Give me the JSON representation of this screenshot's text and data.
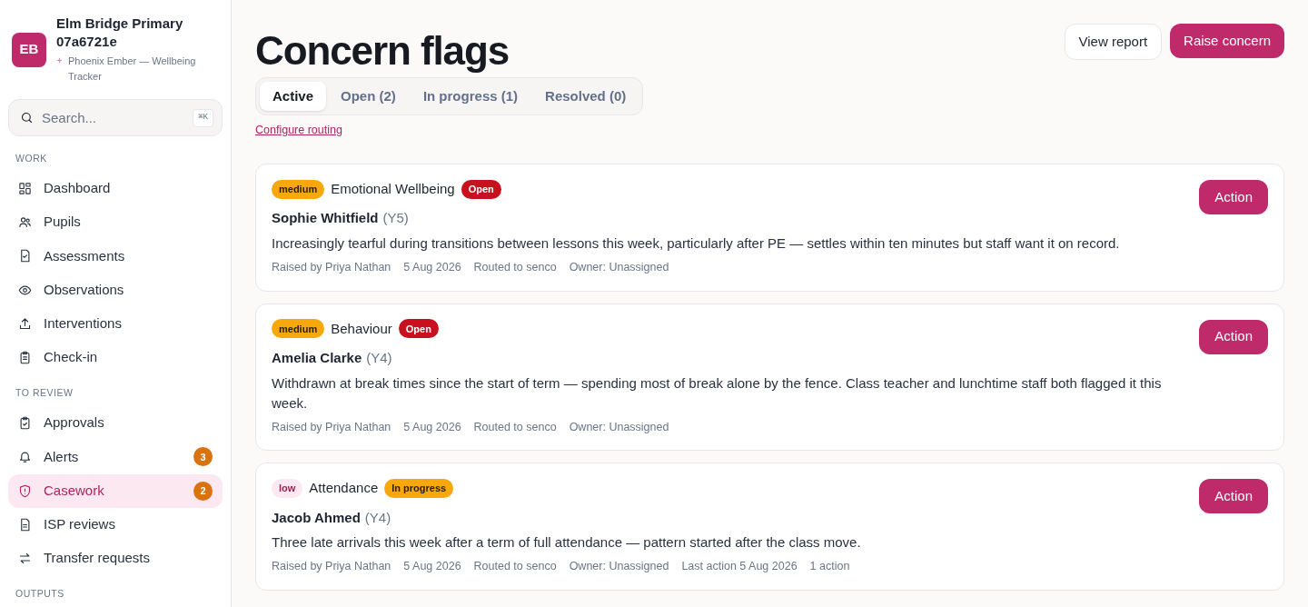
{
  "org": {
    "initials": "EB",
    "name": "Elm Bridge Primary 07a6721e",
    "product": "Phoenix Ember — Wellbeing Tracker"
  },
  "search": {
    "placeholder": "Search...",
    "shortcut": "⌘K"
  },
  "nav_sections": [
    {
      "label": "WORK",
      "items": [
        {
          "label": "Dashboard",
          "selected": false
        },
        {
          "label": "Pupils",
          "selected": false
        },
        {
          "label": "Assessments",
          "selected": false
        },
        {
          "label": "Observations",
          "selected": false
        },
        {
          "label": "Interventions",
          "selected": false
        },
        {
          "label": "Check-in",
          "selected": false
        }
      ]
    },
    {
      "label": "TO REVIEW",
      "items": [
        {
          "label": "Approvals",
          "selected": false
        },
        {
          "label": "Alerts",
          "selected": false,
          "count": "3"
        },
        {
          "label": "Casework",
          "selected": true,
          "count": "2"
        },
        {
          "label": "ISP reviews",
          "selected": false
        },
        {
          "label": "Transfer requests",
          "selected": false
        }
      ]
    },
    {
      "label": "OUTPUTS"
    }
  ],
  "page": {
    "title": "Concern flags",
    "buttons": [
      "View report",
      "Raise concern"
    ],
    "tabs": [
      {
        "label": "Active",
        "selected": true
      },
      {
        "label": "Open (2)",
        "selected": false
      },
      {
        "label": "In progress (1)",
        "selected": false
      },
      {
        "label": "Resolved (0)",
        "selected": false
      }
    ],
    "link": "Configure routing"
  },
  "flags": [
    {
      "severity": {
        "label": "medium",
        "kind": "medium"
      },
      "category": "Emotional Wellbeing",
      "status": {
        "label": "Open",
        "kind": "open"
      },
      "pupil": "Sophie Whitfield",
      "year": "(Y5)",
      "note": "Increasingly tearful during transitions between lessons this week, particularly after PE — settles within ten minutes but staff want it on record.",
      "meta": [
        "Raised by Priya Nathan",
        "5 Aug 2026",
        "Routed to senco",
        "Owner: Unassigned"
      ],
      "action": "Action"
    },
    {
      "severity": {
        "label": "medium",
        "kind": "medium"
      },
      "category": "Behaviour",
      "status": {
        "label": "Open",
        "kind": "open"
      },
      "pupil": "Amelia Clarke",
      "year": "(Y4)",
      "note": "Withdrawn at break times since the start of term — spending most of break alone by the fence. Class teacher and lunchtime staff both flagged it this week.",
      "meta": [
        "Raised by Priya Nathan",
        "5 Aug 2026",
        "Routed to senco",
        "Owner: Unassigned"
      ],
      "action": "Action"
    },
    {
      "severity": {
        "label": "low",
        "kind": "low"
      },
      "category": "Attendance",
      "status": {
        "label": "In progress",
        "kind": "in_progress"
      },
      "pupil": "Jacob Ahmed",
      "year": "(Y4)",
      "note": "Three late arrivals this week after a term of full attendance — pattern started after the class move.",
      "meta": [
        "Raised by Priya Nathan",
        "5 Aug 2026",
        "Routed to senco",
        "Owner: Unassigned",
        "Last action 5 Aug 2026",
        "1 action"
      ],
      "action": "Action"
    }
  ]
}
